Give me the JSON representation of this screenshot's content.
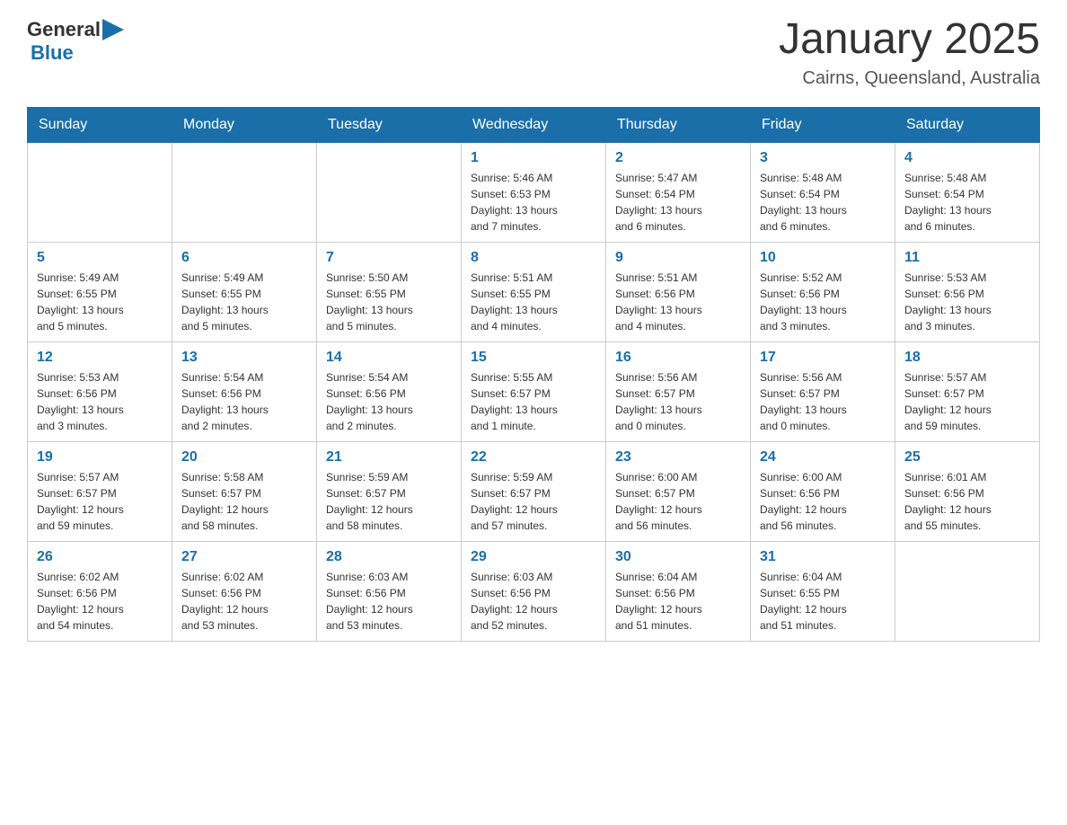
{
  "header": {
    "logo": {
      "text_general": "General",
      "text_blue": "Blue",
      "arrow_color": "#1a6fa8"
    },
    "title": "January 2025",
    "location": "Cairns, Queensland, Australia"
  },
  "calendar": {
    "days_of_week": [
      "Sunday",
      "Monday",
      "Tuesday",
      "Wednesday",
      "Thursday",
      "Friday",
      "Saturday"
    ],
    "weeks": [
      [
        {
          "day": "",
          "info": ""
        },
        {
          "day": "",
          "info": ""
        },
        {
          "day": "",
          "info": ""
        },
        {
          "day": "1",
          "info": "Sunrise: 5:46 AM\nSunset: 6:53 PM\nDaylight: 13 hours\nand 7 minutes."
        },
        {
          "day": "2",
          "info": "Sunrise: 5:47 AM\nSunset: 6:54 PM\nDaylight: 13 hours\nand 6 minutes."
        },
        {
          "day": "3",
          "info": "Sunrise: 5:48 AM\nSunset: 6:54 PM\nDaylight: 13 hours\nand 6 minutes."
        },
        {
          "day": "4",
          "info": "Sunrise: 5:48 AM\nSunset: 6:54 PM\nDaylight: 13 hours\nand 6 minutes."
        }
      ],
      [
        {
          "day": "5",
          "info": "Sunrise: 5:49 AM\nSunset: 6:55 PM\nDaylight: 13 hours\nand 5 minutes."
        },
        {
          "day": "6",
          "info": "Sunrise: 5:49 AM\nSunset: 6:55 PM\nDaylight: 13 hours\nand 5 minutes."
        },
        {
          "day": "7",
          "info": "Sunrise: 5:50 AM\nSunset: 6:55 PM\nDaylight: 13 hours\nand 5 minutes."
        },
        {
          "day": "8",
          "info": "Sunrise: 5:51 AM\nSunset: 6:55 PM\nDaylight: 13 hours\nand 4 minutes."
        },
        {
          "day": "9",
          "info": "Sunrise: 5:51 AM\nSunset: 6:56 PM\nDaylight: 13 hours\nand 4 minutes."
        },
        {
          "day": "10",
          "info": "Sunrise: 5:52 AM\nSunset: 6:56 PM\nDaylight: 13 hours\nand 3 minutes."
        },
        {
          "day": "11",
          "info": "Sunrise: 5:53 AM\nSunset: 6:56 PM\nDaylight: 13 hours\nand 3 minutes."
        }
      ],
      [
        {
          "day": "12",
          "info": "Sunrise: 5:53 AM\nSunset: 6:56 PM\nDaylight: 13 hours\nand 3 minutes."
        },
        {
          "day": "13",
          "info": "Sunrise: 5:54 AM\nSunset: 6:56 PM\nDaylight: 13 hours\nand 2 minutes."
        },
        {
          "day": "14",
          "info": "Sunrise: 5:54 AM\nSunset: 6:56 PM\nDaylight: 13 hours\nand 2 minutes."
        },
        {
          "day": "15",
          "info": "Sunrise: 5:55 AM\nSunset: 6:57 PM\nDaylight: 13 hours\nand 1 minute."
        },
        {
          "day": "16",
          "info": "Sunrise: 5:56 AM\nSunset: 6:57 PM\nDaylight: 13 hours\nand 0 minutes."
        },
        {
          "day": "17",
          "info": "Sunrise: 5:56 AM\nSunset: 6:57 PM\nDaylight: 13 hours\nand 0 minutes."
        },
        {
          "day": "18",
          "info": "Sunrise: 5:57 AM\nSunset: 6:57 PM\nDaylight: 12 hours\nand 59 minutes."
        }
      ],
      [
        {
          "day": "19",
          "info": "Sunrise: 5:57 AM\nSunset: 6:57 PM\nDaylight: 12 hours\nand 59 minutes."
        },
        {
          "day": "20",
          "info": "Sunrise: 5:58 AM\nSunset: 6:57 PM\nDaylight: 12 hours\nand 58 minutes."
        },
        {
          "day": "21",
          "info": "Sunrise: 5:59 AM\nSunset: 6:57 PM\nDaylight: 12 hours\nand 58 minutes."
        },
        {
          "day": "22",
          "info": "Sunrise: 5:59 AM\nSunset: 6:57 PM\nDaylight: 12 hours\nand 57 minutes."
        },
        {
          "day": "23",
          "info": "Sunrise: 6:00 AM\nSunset: 6:57 PM\nDaylight: 12 hours\nand 56 minutes."
        },
        {
          "day": "24",
          "info": "Sunrise: 6:00 AM\nSunset: 6:56 PM\nDaylight: 12 hours\nand 56 minutes."
        },
        {
          "day": "25",
          "info": "Sunrise: 6:01 AM\nSunset: 6:56 PM\nDaylight: 12 hours\nand 55 minutes."
        }
      ],
      [
        {
          "day": "26",
          "info": "Sunrise: 6:02 AM\nSunset: 6:56 PM\nDaylight: 12 hours\nand 54 minutes."
        },
        {
          "day": "27",
          "info": "Sunrise: 6:02 AM\nSunset: 6:56 PM\nDaylight: 12 hours\nand 53 minutes."
        },
        {
          "day": "28",
          "info": "Sunrise: 6:03 AM\nSunset: 6:56 PM\nDaylight: 12 hours\nand 53 minutes."
        },
        {
          "day": "29",
          "info": "Sunrise: 6:03 AM\nSunset: 6:56 PM\nDaylight: 12 hours\nand 52 minutes."
        },
        {
          "day": "30",
          "info": "Sunrise: 6:04 AM\nSunset: 6:56 PM\nDaylight: 12 hours\nand 51 minutes."
        },
        {
          "day": "31",
          "info": "Sunrise: 6:04 AM\nSunset: 6:55 PM\nDaylight: 12 hours\nand 51 minutes."
        },
        {
          "day": "",
          "info": ""
        }
      ]
    ]
  }
}
